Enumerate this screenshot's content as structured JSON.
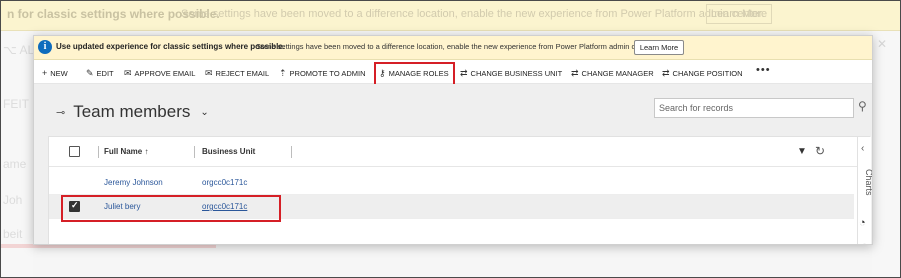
{
  "background": {
    "banner_bold": "n for classic settings where possible.",
    "banner_text": "Some settings have been moved to a difference location, enable the new experience from Power Platform admin center.",
    "banner_button": "Learn More",
    "left_ghost_1": "⌥ AL",
    "left_ghost_2": "FEIT",
    "left_ghost_3": "ame",
    "left_ghost_4": "Joh",
    "left_ghost_5": "beit"
  },
  "message_bar": {
    "icon": "info-icon",
    "bold_text": "Use updated experience for classic settings where possible.",
    "text": "Some settings have been moved to a difference location, enable the new experience from Power Platform admin center.",
    "button_label": "Learn More"
  },
  "toolbar": {
    "items": [
      {
        "label": "NEW",
        "icon": "plus-icon"
      },
      {
        "label": "EDIT",
        "icon": "pencil-icon"
      },
      {
        "label": "APPROVE EMAIL",
        "icon": "approve-email-icon"
      },
      {
        "label": "REJECT EMAIL",
        "icon": "reject-email-icon"
      },
      {
        "label": "PROMOTE TO ADMIN",
        "icon": "promote-icon"
      },
      {
        "label": "MANAGE ROLES",
        "icon": "manage-roles-icon"
      },
      {
        "label": "CHANGE BUSINESS UNIT",
        "icon": "change-business-unit-icon"
      },
      {
        "label": "CHANGE MANAGER",
        "icon": "change-manager-icon"
      },
      {
        "label": "CHANGE POSITION",
        "icon": "change-position-icon"
      }
    ],
    "more": "•••"
  },
  "view": {
    "title": "Team members",
    "search_placeholder": "Search for records"
  },
  "grid": {
    "columns": [
      "Full Name ↑",
      "Business Unit"
    ],
    "rows": [
      {
        "full_name": "Jeremy Johnson",
        "business_unit": "orgcc0c171c",
        "selected": false
      },
      {
        "full_name": "Juliet bery",
        "business_unit": "orgcc0c171c",
        "selected": true
      }
    ]
  },
  "side_panel": {
    "label": "Charts"
  },
  "colors": {
    "accent": "#0f6cbd",
    "highlight": "#d51f26",
    "link": "#2b579a",
    "message_bar": "#fff4ce"
  }
}
